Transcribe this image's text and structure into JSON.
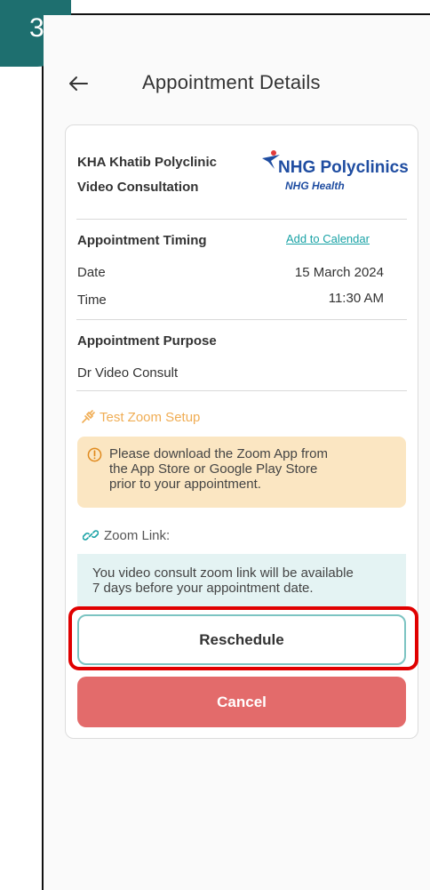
{
  "step_badge": "3",
  "header": {
    "title": "Appointment Details"
  },
  "clinic": {
    "name": "KHA Khatib Polyclinic",
    "consult_type": "Video Consultation",
    "logo_main": "NHG Polyclinics",
    "logo_sub": "NHG Health"
  },
  "timing": {
    "heading": "Appointment Timing",
    "calendar_link": "Add to Calendar",
    "date_label": "Date",
    "date_value": "15 March 2024",
    "time_label": "Time",
    "time_value": "11:30 AM"
  },
  "purpose": {
    "heading": "Appointment Purpose",
    "value": "Dr Video Consult"
  },
  "zoom": {
    "setup_label": "Test Zoom Setup",
    "warning_line1": "Please download the Zoom App from",
    "warning_line2": "the App Store or Google Play Store",
    "warning_line3": "prior to your appointment.",
    "link_label": "Zoom Link:",
    "info_line1": "You video consult zoom link will be available",
    "info_line2": "7 days before your appointment date."
  },
  "actions": {
    "reschedule": "Reschedule",
    "cancel": "Cancel"
  },
  "colors": {
    "badge": "#1e6f6f",
    "accent_teal": "#1aa3a6",
    "cancel_red": "#e36b6b",
    "highlight_red": "#e00000",
    "warning_bg": "#fbe6c2",
    "info_bg": "#e4f3f3",
    "brand_blue": "#1f4da1"
  }
}
